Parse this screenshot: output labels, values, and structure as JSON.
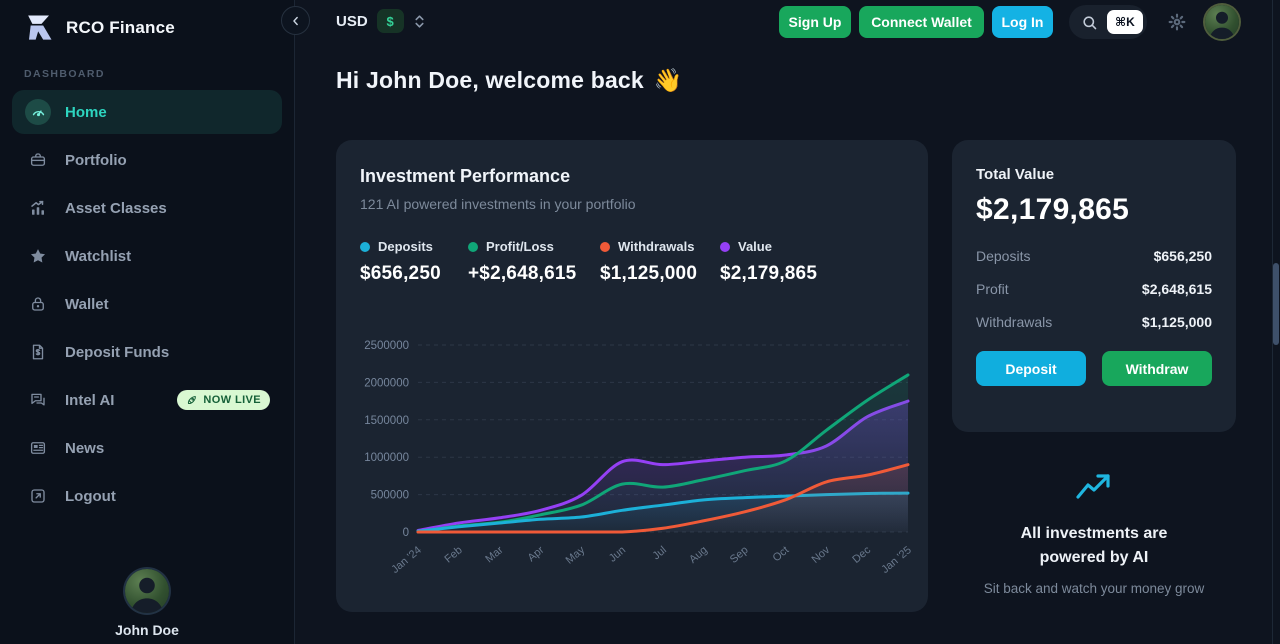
{
  "brand": {
    "name": "RCO Finance"
  },
  "topbar": {
    "currency": {
      "code": "USD",
      "symbol": "$"
    },
    "buttons": {
      "sign_up": "Sign Up",
      "connect_wallet": "Connect Wallet",
      "log_in": "Log In"
    },
    "shortcut": "⌘K"
  },
  "sidebar": {
    "section_label": "DASHBOARD",
    "items": [
      {
        "label": "Home",
        "icon": "gauge-icon",
        "active": true
      },
      {
        "label": "Portfolio",
        "icon": "briefcase-icon",
        "active": false
      },
      {
        "label": "Asset Classes",
        "icon": "chart-bars-icon",
        "active": false
      },
      {
        "label": "Watchlist",
        "icon": "star-icon",
        "active": false
      },
      {
        "label": "Wallet",
        "icon": "lock-icon",
        "active": false
      },
      {
        "label": "Deposit Funds",
        "icon": "dollar-file-icon",
        "active": false
      },
      {
        "label": "Intel AI",
        "icon": "chat-icon",
        "active": false,
        "badge": "NOW LIVE"
      },
      {
        "label": "News",
        "icon": "news-icon",
        "active": false
      },
      {
        "label": "Logout",
        "icon": "logout-icon",
        "active": false
      }
    ],
    "user": {
      "name": "John Doe"
    }
  },
  "header": {
    "greeting": "Hi John Doe, welcome back",
    "wave_emoji": "👋"
  },
  "performance_card": {
    "title": "Investment Performance",
    "subtitle": "121 AI powered investments in your portfolio",
    "legend": [
      {
        "label": "Deposits",
        "value": "$656,250",
        "color": "#1cb0d8"
      },
      {
        "label": "Profit/Loss",
        "value": "+$2,648,615",
        "color": "#10a678"
      },
      {
        "label": "Withdrawals",
        "value": "$1,125,000",
        "color": "#f05a38"
      },
      {
        "label": "Value",
        "value": "$2,179,865",
        "color": "#9540f5"
      }
    ]
  },
  "chart_data": {
    "type": "area",
    "x": [
      "Jan '24",
      "Feb",
      "Mar",
      "Apr",
      "May",
      "Jun",
      "Jul",
      "Aug",
      "Sep",
      "Oct",
      "Nov",
      "Dec",
      "Jan '25"
    ],
    "series": [
      {
        "name": "Deposits",
        "color": "#1cb0d8",
        "values": [
          10000,
          70000,
          120000,
          170000,
          200000,
          290000,
          360000,
          430000,
          460000,
          480000,
          500000,
          515000,
          520000
        ]
      },
      {
        "name": "Profit/Loss",
        "color": "#10a678",
        "values": [
          0,
          80000,
          130000,
          230000,
          360000,
          640000,
          600000,
          700000,
          820000,
          950000,
          1360000,
          1760000,
          2100000
        ]
      },
      {
        "name": "Withdrawals",
        "color": "#f05a38",
        "values": [
          0,
          0,
          0,
          0,
          0,
          0,
          50000,
          150000,
          270000,
          430000,
          670000,
          760000,
          900000
        ]
      },
      {
        "name": "Value",
        "color": "#9540f5",
        "values": [
          20000,
          120000,
          190000,
          290000,
          490000,
          940000,
          900000,
          950000,
          1000000,
          1030000,
          1150000,
          1540000,
          1750000
        ]
      }
    ],
    "ylim": [
      0,
      2500000
    ],
    "yticks": [
      0,
      500000,
      1000000,
      1500000,
      2000000,
      2500000
    ],
    "grid": "dashed-horizontal",
    "legend_position": "above-chart"
  },
  "total_value_card": {
    "title": "Total Value",
    "total": "$2,179,865",
    "rows": [
      {
        "label": "Deposits",
        "value": "$656,250"
      },
      {
        "label": "Profit",
        "value": "$2,648,615"
      },
      {
        "label": "Withdrawals",
        "value": "$1,125,000"
      }
    ],
    "buttons": {
      "deposit": "Deposit",
      "withdraw": "Withdraw"
    }
  },
  "ai_note": {
    "title_line1": "All investments are",
    "title_line2": "powered by AI",
    "subtitle": "Sit back and watch your money grow"
  },
  "colors": {
    "accent_teal": "#2dd4bf",
    "green_button": "#18a75c",
    "cyan_button": "#14b2e4",
    "card_bg": "#1b2431",
    "page_bg": "#0e141f",
    "sidebar_bg": "#0b111b"
  }
}
